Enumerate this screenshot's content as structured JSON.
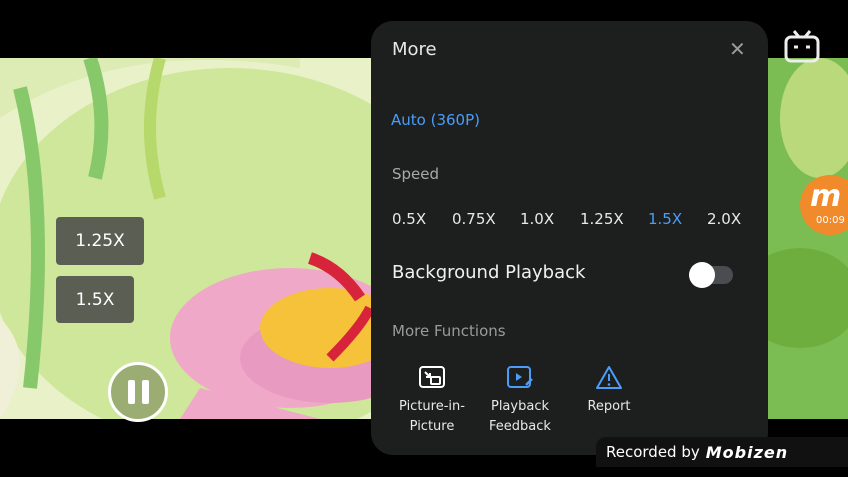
{
  "overlay": {
    "chips": [
      "1.25X",
      "1.5X"
    ]
  },
  "recorder": {
    "timer": "00:09"
  },
  "panel": {
    "title": "More",
    "quality": "Auto (360P)",
    "speed_label": "Speed",
    "speeds": [
      "0.5X",
      "0.75X",
      "1.0X",
      "1.25X",
      "1.5X",
      "2.0X"
    ],
    "selected_speed": "1.5X",
    "background_playback": "Background Playback",
    "background_playback_enabled": false,
    "more_functions": "More Functions",
    "functions": [
      "Picture-in-\nPicture",
      "Playback\nFeedback",
      "Report"
    ]
  },
  "watermark": {
    "text": "Recorded by",
    "brand": "Mobizen"
  },
  "colors": {
    "accent": "#4a9df8",
    "panel_bg": "#1d1f1f",
    "recorder_badge": "#f08a2a"
  },
  "icons": [
    "pause-icon",
    "tv-icon",
    "close-icon",
    "picture-in-picture-icon",
    "playback-feedback-icon",
    "warning-icon",
    "recorder-logo-icon"
  ]
}
